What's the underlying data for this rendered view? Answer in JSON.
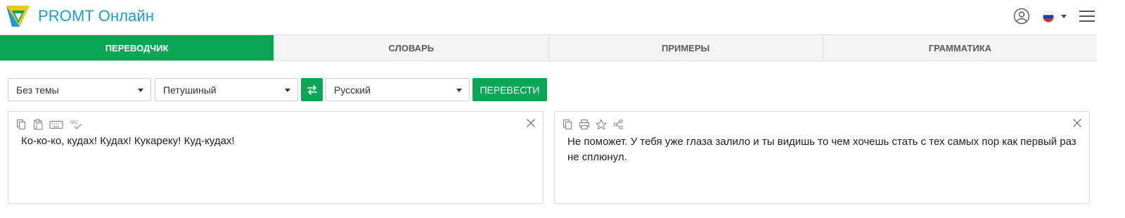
{
  "header": {
    "brand": "PROMT Онлайн",
    "icons": [
      "promt-logo",
      "user-icon",
      "russia-flag-icon",
      "hamburger-menu-icon"
    ],
    "colors": {
      "brand_blue": "#1a9ad6",
      "accent_green": "#0aa656"
    }
  },
  "tabs": [
    {
      "label": "ПЕРЕВОДЧИК",
      "active": true
    },
    {
      "label": "СЛОВАРЬ",
      "active": false
    },
    {
      "label": "ПРИМЕРЫ",
      "active": false
    },
    {
      "label": "ГРАММАТИКА",
      "active": false
    }
  ],
  "controls": {
    "topic_select": "Без темы",
    "source_lang_select": "Петушиный",
    "target_lang_select": "Русский",
    "translate_label": "ПЕРЕВЕСТИ"
  },
  "source": {
    "text": "Ко-ко-ко, кудах! Кудах! Кукареку! Куд-кудах!",
    "toolbar_icons": [
      "copy-icon",
      "paste-icon",
      "keyboard-icon",
      "spellcheck-icon"
    ],
    "spellcheck_label": "ABC"
  },
  "target": {
    "text": "Не поможет. У тебя уже глаза залило и ты видишь то чем хочешь стать с тех самых пор как первый раз не сплюнул.",
    "toolbar_icons": [
      "copy-icon",
      "print-icon",
      "star-icon",
      "share-icon"
    ]
  }
}
